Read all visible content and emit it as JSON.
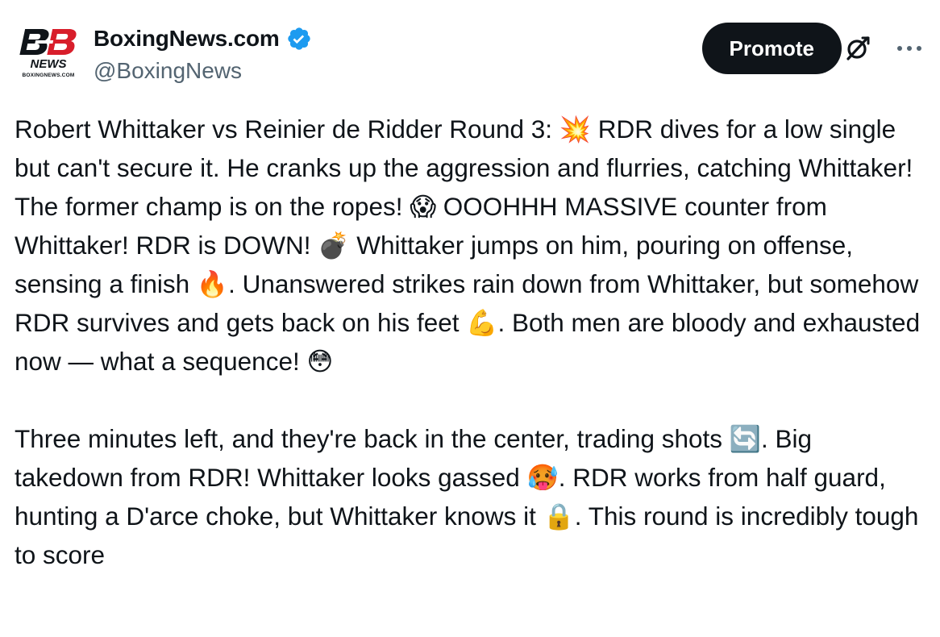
{
  "author": {
    "display_name": "BoxingNews.com",
    "handle": "@BoxingNews",
    "verified": true,
    "logo": {
      "mark": "BB",
      "wordmark": "NEWS",
      "url_text": "BOXINGNEWS.COM",
      "accent_color": "#d81e2b"
    }
  },
  "actions": {
    "promote_label": "Promote",
    "grok_icon": "grok-icon",
    "more_icon": "more-icon"
  },
  "tweet": {
    "paragraphs": [
      "Robert Whittaker vs Reinier de Ridder Round 3: 💥 RDR dives for a low single but can't secure it. He cranks up the aggression and flurries, catching Whittaker! The former champ is on the ropes! 😱 OOOHHH MASSIVE counter from Whittaker! RDR is DOWN! 💣 Whittaker jumps on him, pouring on offense, sensing a finish 🔥. Unanswered strikes rain down from Whittaker, but somehow RDR survives and gets back on his feet 💪. Both men are bloody and exhausted now — what a sequence! 😳",
      "Three minutes left, and they're back in the center, trading shots 🔄. Big takedown from RDR! Whittaker looks gassed 🥵. RDR works from half guard, hunting a D'arce choke, but Whittaker knows it 🔒. This round is incredibly tough to score"
    ]
  },
  "colors": {
    "text": "#0f1419",
    "secondary_text": "#536471",
    "verified_blue": "#1d9bf0",
    "button_bg": "#0f1419",
    "button_text": "#ffffff"
  }
}
